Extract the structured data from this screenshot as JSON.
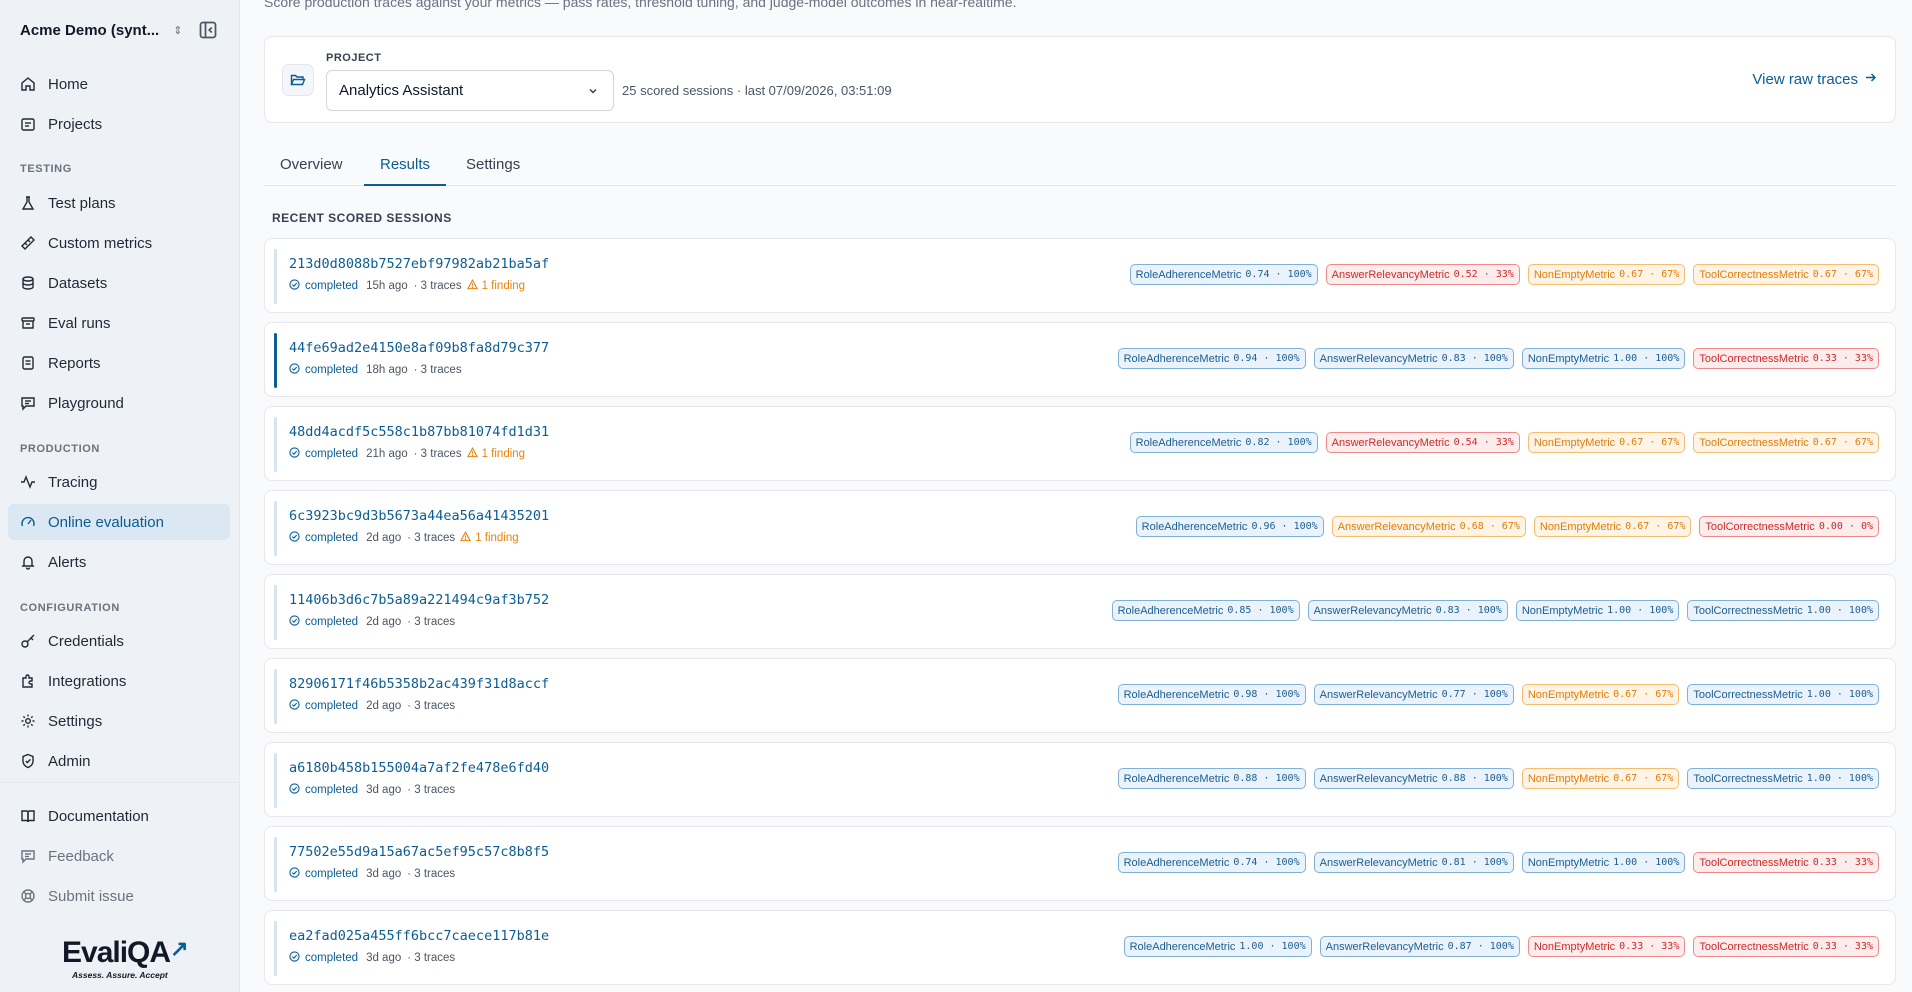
{
  "workspace": {
    "name": "Acme Demo (synt..."
  },
  "nav": {
    "home": "Home",
    "projects": "Projects",
    "testing_label": "TESTING",
    "test_plans": "Test plans",
    "custom_metrics": "Custom metrics",
    "datasets": "Datasets",
    "eval_runs": "Eval runs",
    "reports": "Reports",
    "playground": "Playground",
    "production_label": "PRODUCTION",
    "tracing": "Tracing",
    "online_evaluation": "Online evaluation",
    "alerts": "Alerts",
    "configuration_label": "CONFIGURATION",
    "credentials": "Credentials",
    "integrations": "Integrations",
    "settings": "Settings",
    "admin": "Admin",
    "documentation": "Documentation",
    "feedback": "Feedback",
    "submit_issue": "Submit issue"
  },
  "logo": {
    "name": "EvaliQA",
    "tagline": "Assess. Assure. Accept"
  },
  "page": {
    "subtitle": "Score production traces against your metrics — pass rates, threshold tuning, and judge-model outcomes in near-realtime."
  },
  "project": {
    "label": "PROJECT",
    "selected": "Analytics Assistant",
    "meta": "25 scored sessions · last 07/09/2026, 03:51:09",
    "raw_link": "View raw traces"
  },
  "tabs": {
    "overview": "Overview",
    "results": "Results",
    "settings": "Settings",
    "active": "Results"
  },
  "sessions_title": "RECENT SCORED SESSIONS",
  "colors": {
    "accent": "#0b5d93",
    "pass": "#1b5e91",
    "fail": "#cc2b2b",
    "warn": "#e07d0b"
  },
  "sessions": [
    {
      "id": "213d0d8088b7527ebf97982ab21ba5af",
      "status": "completed",
      "age": "15h ago",
      "traces": "· 3 traces",
      "finding": "1 finding",
      "metrics": [
        {
          "name": "RoleAdherenceMetric",
          "score": "0.74 · 100%",
          "level": "blue"
        },
        {
          "name": "AnswerRelevancyMetric",
          "score": "0.52 · 33%",
          "level": "red"
        },
        {
          "name": "NonEmptyMetric",
          "score": "0.67 · 67%",
          "level": "orange"
        },
        {
          "name": "ToolCorrectnessMetric",
          "score": "0.67 · 67%",
          "level": "orange"
        }
      ]
    },
    {
      "id": "44fe69ad2e4150e8af09b8fa8d79c377",
      "status": "completed",
      "age": "18h ago",
      "traces": "· 3 traces",
      "finding": "",
      "selected": true,
      "metrics": [
        {
          "name": "RoleAdherenceMetric",
          "score": "0.94 · 100%",
          "level": "blue"
        },
        {
          "name": "AnswerRelevancyMetric",
          "score": "0.83 · 100%",
          "level": "blue"
        },
        {
          "name": "NonEmptyMetric",
          "score": "1.00 · 100%",
          "level": "blue"
        },
        {
          "name": "ToolCorrectnessMetric",
          "score": "0.33 · 33%",
          "level": "red"
        }
      ]
    },
    {
      "id": "48dd4acdf5c558c1b87bb81074fd1d31",
      "status": "completed",
      "age": "21h ago",
      "traces": "· 3 traces",
      "finding": "1 finding",
      "metrics": [
        {
          "name": "RoleAdherenceMetric",
          "score": "0.82 · 100%",
          "level": "blue"
        },
        {
          "name": "AnswerRelevancyMetric",
          "score": "0.54 · 33%",
          "level": "red"
        },
        {
          "name": "NonEmptyMetric",
          "score": "0.67 · 67%",
          "level": "orange"
        },
        {
          "name": "ToolCorrectnessMetric",
          "score": "0.67 · 67%",
          "level": "orange"
        }
      ]
    },
    {
      "id": "6c3923bc9d3b5673a44ea56a41435201",
      "status": "completed",
      "age": "2d ago",
      "traces": "· 3 traces",
      "finding": "1 finding",
      "metrics": [
        {
          "name": "RoleAdherenceMetric",
          "score": "0.96 · 100%",
          "level": "blue"
        },
        {
          "name": "AnswerRelevancyMetric",
          "score": "0.68 · 67%",
          "level": "orange"
        },
        {
          "name": "NonEmptyMetric",
          "score": "0.67 · 67%",
          "level": "orange"
        },
        {
          "name": "ToolCorrectnessMetric",
          "score": "0.00 · 0%",
          "level": "red"
        }
      ]
    },
    {
      "id": "11406b3d6c7b5a89a221494c9af3b752",
      "status": "completed",
      "age": "2d ago",
      "traces": "· 3 traces",
      "finding": "",
      "metrics": [
        {
          "name": "RoleAdherenceMetric",
          "score": "0.85 · 100%",
          "level": "blue"
        },
        {
          "name": "AnswerRelevancyMetric",
          "score": "0.83 · 100%",
          "level": "blue"
        },
        {
          "name": "NonEmptyMetric",
          "score": "1.00 · 100%",
          "level": "blue"
        },
        {
          "name": "ToolCorrectnessMetric",
          "score": "1.00 · 100%",
          "level": "blue"
        }
      ]
    },
    {
      "id": "82906171f46b5358b2ac439f31d8accf",
      "status": "completed",
      "age": "2d ago",
      "traces": "· 3 traces",
      "finding": "",
      "metrics": [
        {
          "name": "RoleAdherenceMetric",
          "score": "0.98 · 100%",
          "level": "blue"
        },
        {
          "name": "AnswerRelevancyMetric",
          "score": "0.77 · 100%",
          "level": "blue"
        },
        {
          "name": "NonEmptyMetric",
          "score": "0.67 · 67%",
          "level": "orange"
        },
        {
          "name": "ToolCorrectnessMetric",
          "score": "1.00 · 100%",
          "level": "blue"
        }
      ]
    },
    {
      "id": "a6180b458b155004a7af2fe478e6fd40",
      "status": "completed",
      "age": "3d ago",
      "traces": "· 3 traces",
      "finding": "",
      "metrics": [
        {
          "name": "RoleAdherenceMetric",
          "score": "0.88 · 100%",
          "level": "blue"
        },
        {
          "name": "AnswerRelevancyMetric",
          "score": "0.88 · 100%",
          "level": "blue"
        },
        {
          "name": "NonEmptyMetric",
          "score": "0.67 · 67%",
          "level": "orange"
        },
        {
          "name": "ToolCorrectnessMetric",
          "score": "1.00 · 100%",
          "level": "blue"
        }
      ]
    },
    {
      "id": "77502e55d9a15a67ac5ef95c57c8b8f5",
      "status": "completed",
      "age": "3d ago",
      "traces": "· 3 traces",
      "finding": "",
      "metrics": [
        {
          "name": "RoleAdherenceMetric",
          "score": "0.74 · 100%",
          "level": "blue"
        },
        {
          "name": "AnswerRelevancyMetric",
          "score": "0.81 · 100%",
          "level": "blue"
        },
        {
          "name": "NonEmptyMetric",
          "score": "1.00 · 100%",
          "level": "blue"
        },
        {
          "name": "ToolCorrectnessMetric",
          "score": "0.33 · 33%",
          "level": "red"
        }
      ]
    },
    {
      "id": "ea2fad025a455ff6bcc7caece117b81e",
      "status": "completed",
      "age": "3d ago",
      "traces": "· 3 traces",
      "finding": "",
      "metrics": [
        {
          "name": "RoleAdherenceMetric",
          "score": "1.00 · 100%",
          "level": "blue"
        },
        {
          "name": "AnswerRelevancyMetric",
          "score": "0.87 · 100%",
          "level": "blue"
        },
        {
          "name": "NonEmptyMetric",
          "score": "0.33 · 33%",
          "level": "red"
        },
        {
          "name": "ToolCorrectnessMetric",
          "score": "0.33 · 33%",
          "level": "red"
        }
      ]
    }
  ]
}
